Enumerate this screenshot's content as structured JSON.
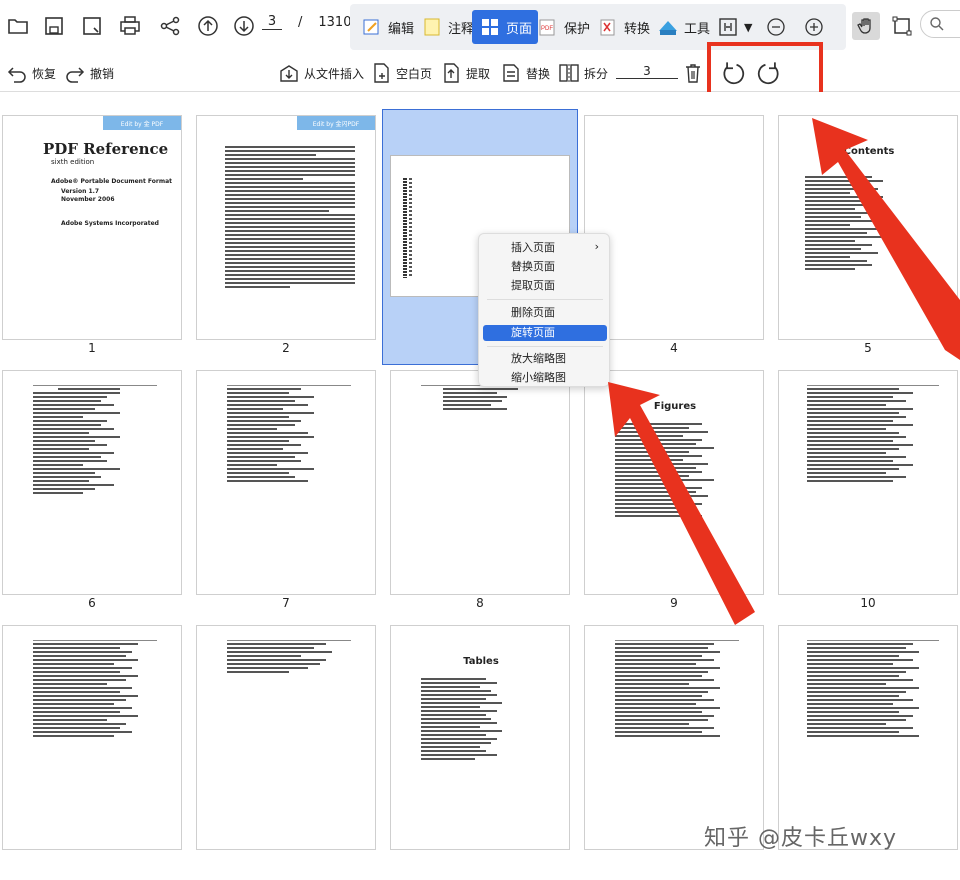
{
  "toolbar": {
    "page_current": "3",
    "page_sep": "/",
    "page_total": "1310",
    "tabs": [
      {
        "label": "编辑",
        "icon": "edit-icon"
      },
      {
        "label": "注释",
        "icon": "annotate-icon"
      },
      {
        "label": "页面",
        "icon": "page-icon"
      },
      {
        "label": "保护",
        "icon": "protect-icon"
      },
      {
        "label": "转换",
        "icon": "convert-icon"
      },
      {
        "label": "工具",
        "icon": "tools-icon"
      }
    ]
  },
  "toolbar2": {
    "undo": "恢复",
    "redo": "撤销",
    "insert_from_file": "从文件插入",
    "blank_page": "空白页",
    "extract": "提取",
    "replace": "替换",
    "split": "拆分",
    "page_input": "3"
  },
  "thumbnails": [
    {
      "num": "1"
    },
    {
      "num": "2"
    },
    {
      "num": "3"
    },
    {
      "num": "4"
    },
    {
      "num": "5"
    },
    {
      "num": "6"
    },
    {
      "num": "7"
    },
    {
      "num": "8"
    },
    {
      "num": "9"
    },
    {
      "num": "10"
    }
  ],
  "thumb_text": {
    "p1_title": "PDF Reference",
    "p1_edition": "sixth edition",
    "p1_format": "Adobe® Portable Document Format",
    "p1_version": "Version 1.7",
    "p1_date": "November 2006",
    "p1_company": "Adobe Systems Incorporated",
    "p1_tag": "Edit by 金 PDF",
    "p2_tag": "Edit by 金闪PDF",
    "p5_title": "Contents",
    "p9_title": "Figures",
    "p13_title": "Tables"
  },
  "context_menu": {
    "items": [
      "插入页面",
      "替换页面",
      "提取页面",
      "删除页面",
      "旋转页面",
      "放大缩略图",
      "缩小缩略图"
    ],
    "highlighted": "旋转页面"
  },
  "watermark": "知乎 @皮卡丘wxy",
  "colors": {
    "accent": "#2f6fe0",
    "selection": "#b8d1f7",
    "annotation_red": "#e8321e"
  }
}
